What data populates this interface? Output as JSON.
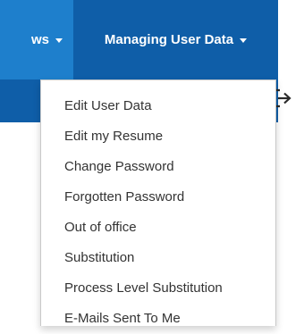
{
  "navbar": {
    "items": [
      {
        "label": "ws"
      },
      {
        "label": "Managing User Data"
      }
    ]
  },
  "dropdown": {
    "items": [
      {
        "label": "Edit User Data"
      },
      {
        "label": "Edit my Resume"
      },
      {
        "label": "Change Password"
      },
      {
        "label": "Forgotten Password"
      },
      {
        "label": "Out of office"
      },
      {
        "label": "Substitution"
      },
      {
        "label": "Process Level Substitution"
      },
      {
        "label": "E-Mails Sent To Me"
      }
    ]
  },
  "colors": {
    "nav_bg": "#1e7fcc",
    "nav_active_bg": "#0f5ea8",
    "menu_text": "#333333"
  },
  "icons": {
    "exit": "exit-icon",
    "caret": "caret-down-icon"
  }
}
